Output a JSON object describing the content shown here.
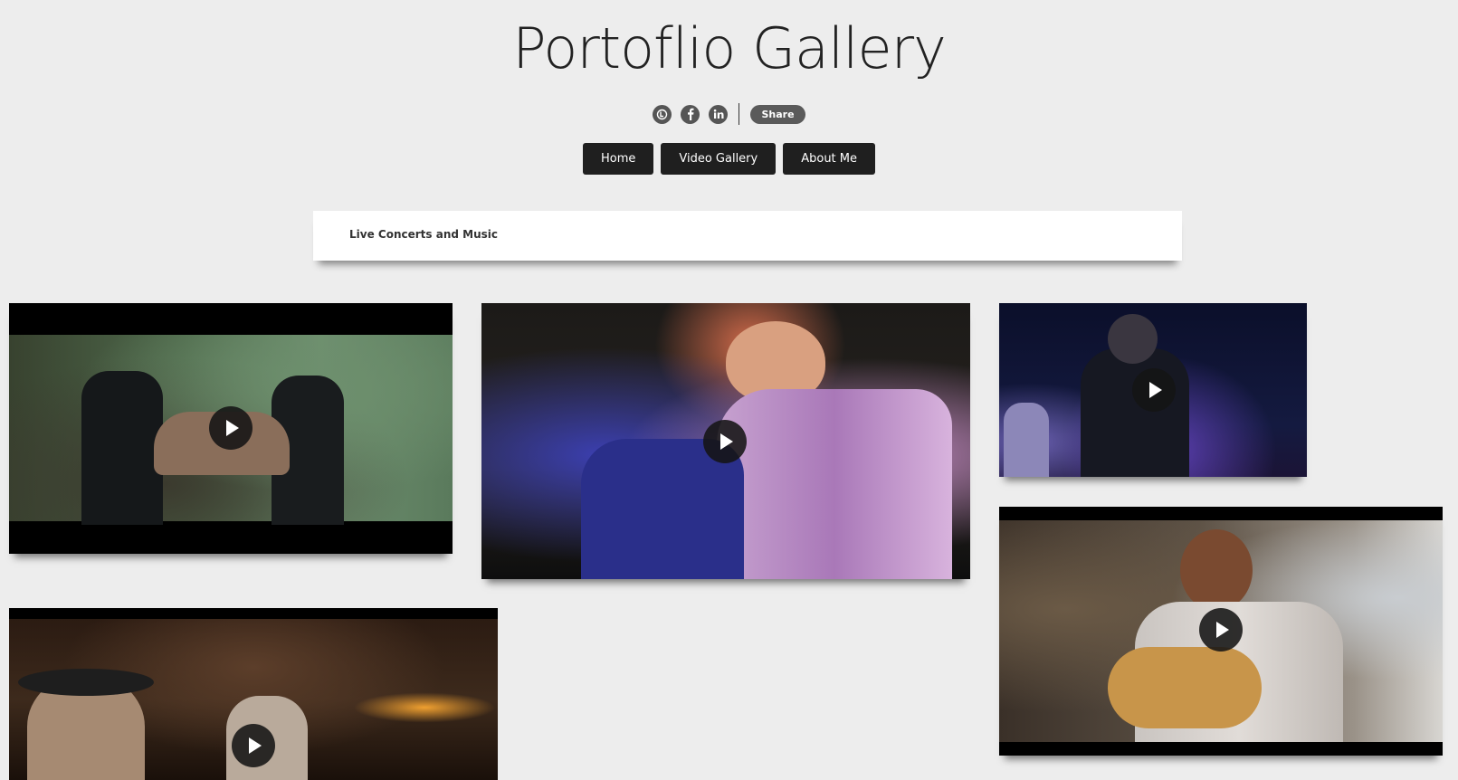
{
  "site": {
    "title": "Portoflio Gallery"
  },
  "social": {
    "icons": [
      "twitter-icon",
      "facebook-icon",
      "linkedin-icon"
    ],
    "share_label": "Share"
  },
  "nav": {
    "items": [
      {
        "label": "Home"
      },
      {
        "label": "Video Gallery"
      },
      {
        "label": "About Me"
      }
    ]
  },
  "banner": {
    "text": "Live Concerts and Music"
  },
  "colors": {
    "background": "#ededed",
    "nav_bg": "#1f1f1f",
    "share_bg": "#5a5a5a"
  },
  "videos": [
    {
      "icon": "play-icon"
    },
    {
      "icon": "play-icon"
    },
    {
      "icon": "play-icon"
    },
    {
      "icon": "play-icon"
    },
    {
      "icon": "play-icon"
    }
  ]
}
